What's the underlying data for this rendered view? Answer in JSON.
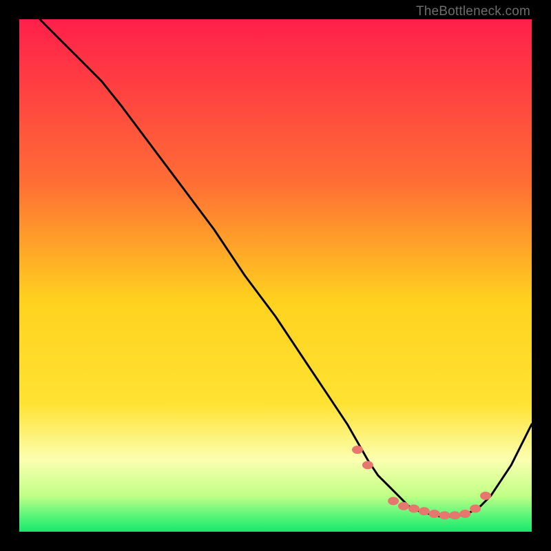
{
  "watermark": "TheBottleneck.com",
  "colors": {
    "frame": "#000000",
    "curve": "#000000",
    "dot_fill": "#e7766f",
    "dot_stroke": "#e7766f",
    "grad_top": "#ff1f4b",
    "grad_mid_high": "#ff8f2c",
    "grad_mid": "#ffe233",
    "grad_low": "#ffff6a",
    "grad_lower": "#c9ff6a",
    "grad_bottom": "#17e86b"
  },
  "chart_data": {
    "type": "line",
    "title": "",
    "xlabel": "",
    "ylabel": "",
    "xlim": [
      0,
      100
    ],
    "ylim": [
      0,
      100
    ],
    "series": [
      {
        "name": "curve",
        "x": [
          4,
          8,
          12,
          16,
          20,
          26,
          32,
          38,
          44,
          50,
          56,
          60,
          64,
          68,
          70,
          72,
          74,
          76,
          78,
          80,
          82,
          84,
          86,
          88,
          90,
          92,
          94,
          96,
          98,
          100
        ],
        "y": [
          100,
          96,
          92,
          88,
          83,
          75,
          67,
          59,
          50,
          42,
          33,
          27,
          21,
          14,
          11,
          9,
          7,
          5,
          4,
          3.5,
          3,
          3,
          3.2,
          3.8,
          5,
          7,
          10,
          13,
          17,
          21
        ]
      }
    ],
    "dots": {
      "name": "highlight-points",
      "x": [
        66,
        68,
        73,
        75,
        77,
        79,
        81,
        83,
        85,
        87,
        89,
        91
      ],
      "y": [
        16,
        13,
        6,
        5,
        4.5,
        4,
        3.5,
        3.2,
        3.2,
        3.5,
        4.5,
        7
      ]
    }
  }
}
